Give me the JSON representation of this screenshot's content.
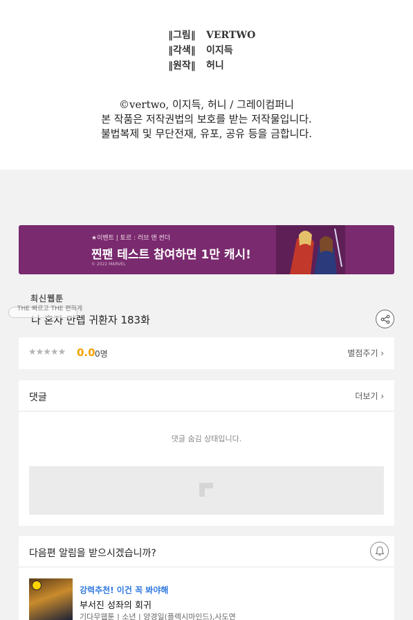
{
  "credits": {
    "lines": [
      {
        "key": "‖그림‖",
        "value": "VERTWO"
      },
      {
        "key": "‖각색‖",
        "value": "이지득"
      },
      {
        "key": "‖원작‖",
        "value": "허니"
      }
    ],
    "copyright": "©vertwo, 이지득, 허니 / 그레이컴퍼니",
    "notice1": "본 작품은 저작권법의 보호를 받는 저작물입니다.",
    "notice2": "불법복제 및 무단전재, 유포, 공유 등을 금합니다."
  },
  "banner": {
    "event_label": "★이벤트 | 토르 : 러브 앤 썬더",
    "headline": "찐팬 테스트 참여하면 1만 캐시!",
    "mark": "© 2022 MARVEL",
    "bg_color": "#7a2a6e"
  },
  "episode": {
    "title": "나 혼자 만렙 귀환자 183화",
    "logo_main": "최신웹툰",
    "logo_sub": "THE 빠르고 THE 편하게",
    "share_icon": "share-icon"
  },
  "rating": {
    "stars": "★★★★★",
    "score": "0.0",
    "count": "0명",
    "rate_label": "별점주기 ›",
    "score_color": "#f5a200"
  },
  "comments": {
    "title": "댓글",
    "more_label": "더보기 ›",
    "hidden_message": "댓글 숨김 상태입니다."
  },
  "notify": {
    "title": "다음편 알림을 받으시겠습니까?",
    "bell_icon": "bell-icon"
  },
  "recommendation": {
    "tag": "강력추천! 이건 꼭 봐야해",
    "title": "부서진 성좌의 회귀",
    "meta": "기다무웹툰 | 소년 | 양경일(플렉시마인드),사도연",
    "tag_color": "#2e78e0"
  }
}
